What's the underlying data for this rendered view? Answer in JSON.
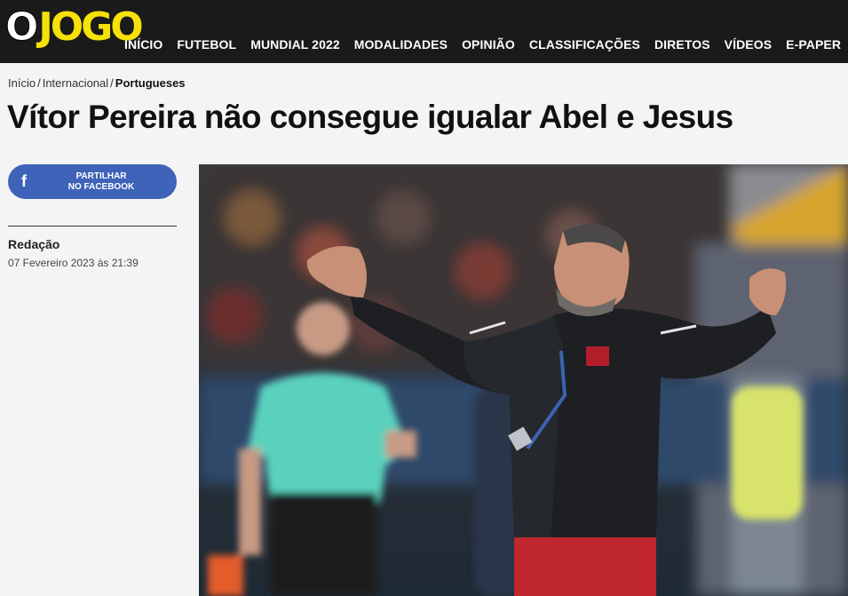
{
  "logo": {
    "o": "O",
    "jogo": "JOGO"
  },
  "nav": [
    "INÍCIO",
    "FUTEBOL",
    "MUNDIAL 2022",
    "MODALIDADES",
    "OPINIÃO",
    "CLASSIFICAÇÕES",
    "DIRETOS",
    "VÍDEOS",
    "E-PAPER"
  ],
  "breadcrumb": {
    "home": "Início",
    "section": "Internacional",
    "current": "Portugueses"
  },
  "article": {
    "title": "Vítor Pereira não consegue igualar Abel e Jesus",
    "author": "Redação",
    "date": "07 Fevereiro 2023 às 21:39"
  },
  "share": {
    "line1": "PARTILHAR",
    "line2": "NO FACEBOOK",
    "icon": "facebook-icon"
  },
  "colors": {
    "topbar": "#1a1a1a",
    "logo_yellow": "#f6e10a",
    "facebook": "#3e63b8"
  }
}
